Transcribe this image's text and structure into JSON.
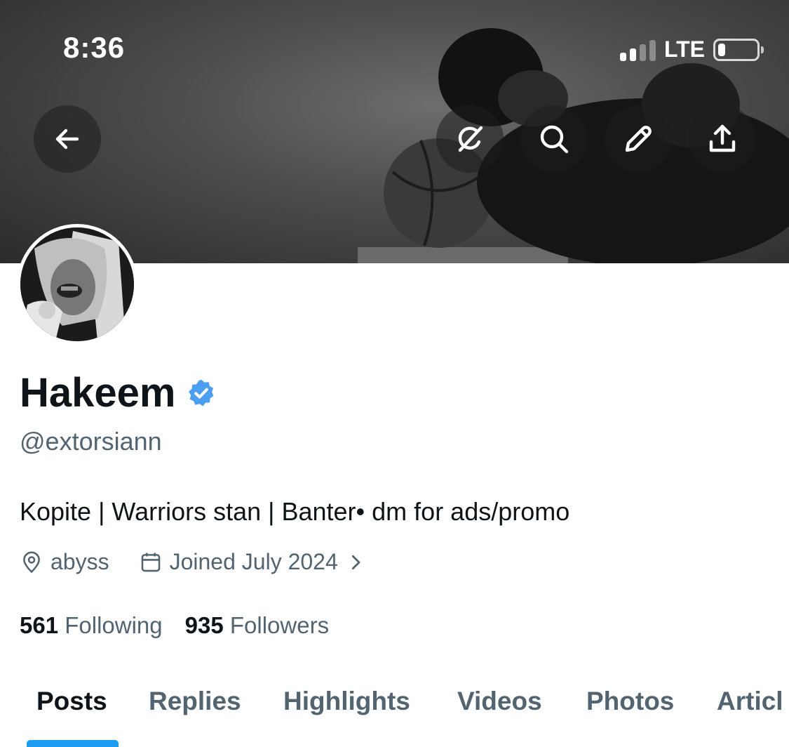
{
  "status_bar": {
    "time": "8:36",
    "network": "LTE",
    "signal_bars": 2,
    "battery_level": 0.15
  },
  "header": {
    "back_icon": "arrow-left-icon",
    "actions": [
      {
        "name": "grok-icon"
      },
      {
        "name": "search-icon"
      },
      {
        "name": "edit-icon"
      },
      {
        "name": "share-icon"
      }
    ]
  },
  "profile": {
    "display_name": "Hakeem",
    "verified": true,
    "verified_color": "#4c9ef2",
    "handle": "@extorsiann",
    "bio": "Kopite | Warriors stan | Banter• dm for ads/promo",
    "location": "abyss",
    "joined": "Joined July 2024",
    "following_count": "561",
    "following_label": "Following",
    "followers_count": "935",
    "followers_label": "Followers"
  },
  "tabs": [
    {
      "label": "Posts",
      "active": true
    },
    {
      "label": "Replies",
      "active": false
    },
    {
      "label": "Highlights",
      "active": false
    },
    {
      "label": "Videos",
      "active": false
    },
    {
      "label": "Photos",
      "active": false
    },
    {
      "label": "Articl",
      "active": false
    }
  ],
  "colors": {
    "accent": "#1d9bf0",
    "secondary_text": "#536471",
    "primary_text": "#0f1419"
  }
}
